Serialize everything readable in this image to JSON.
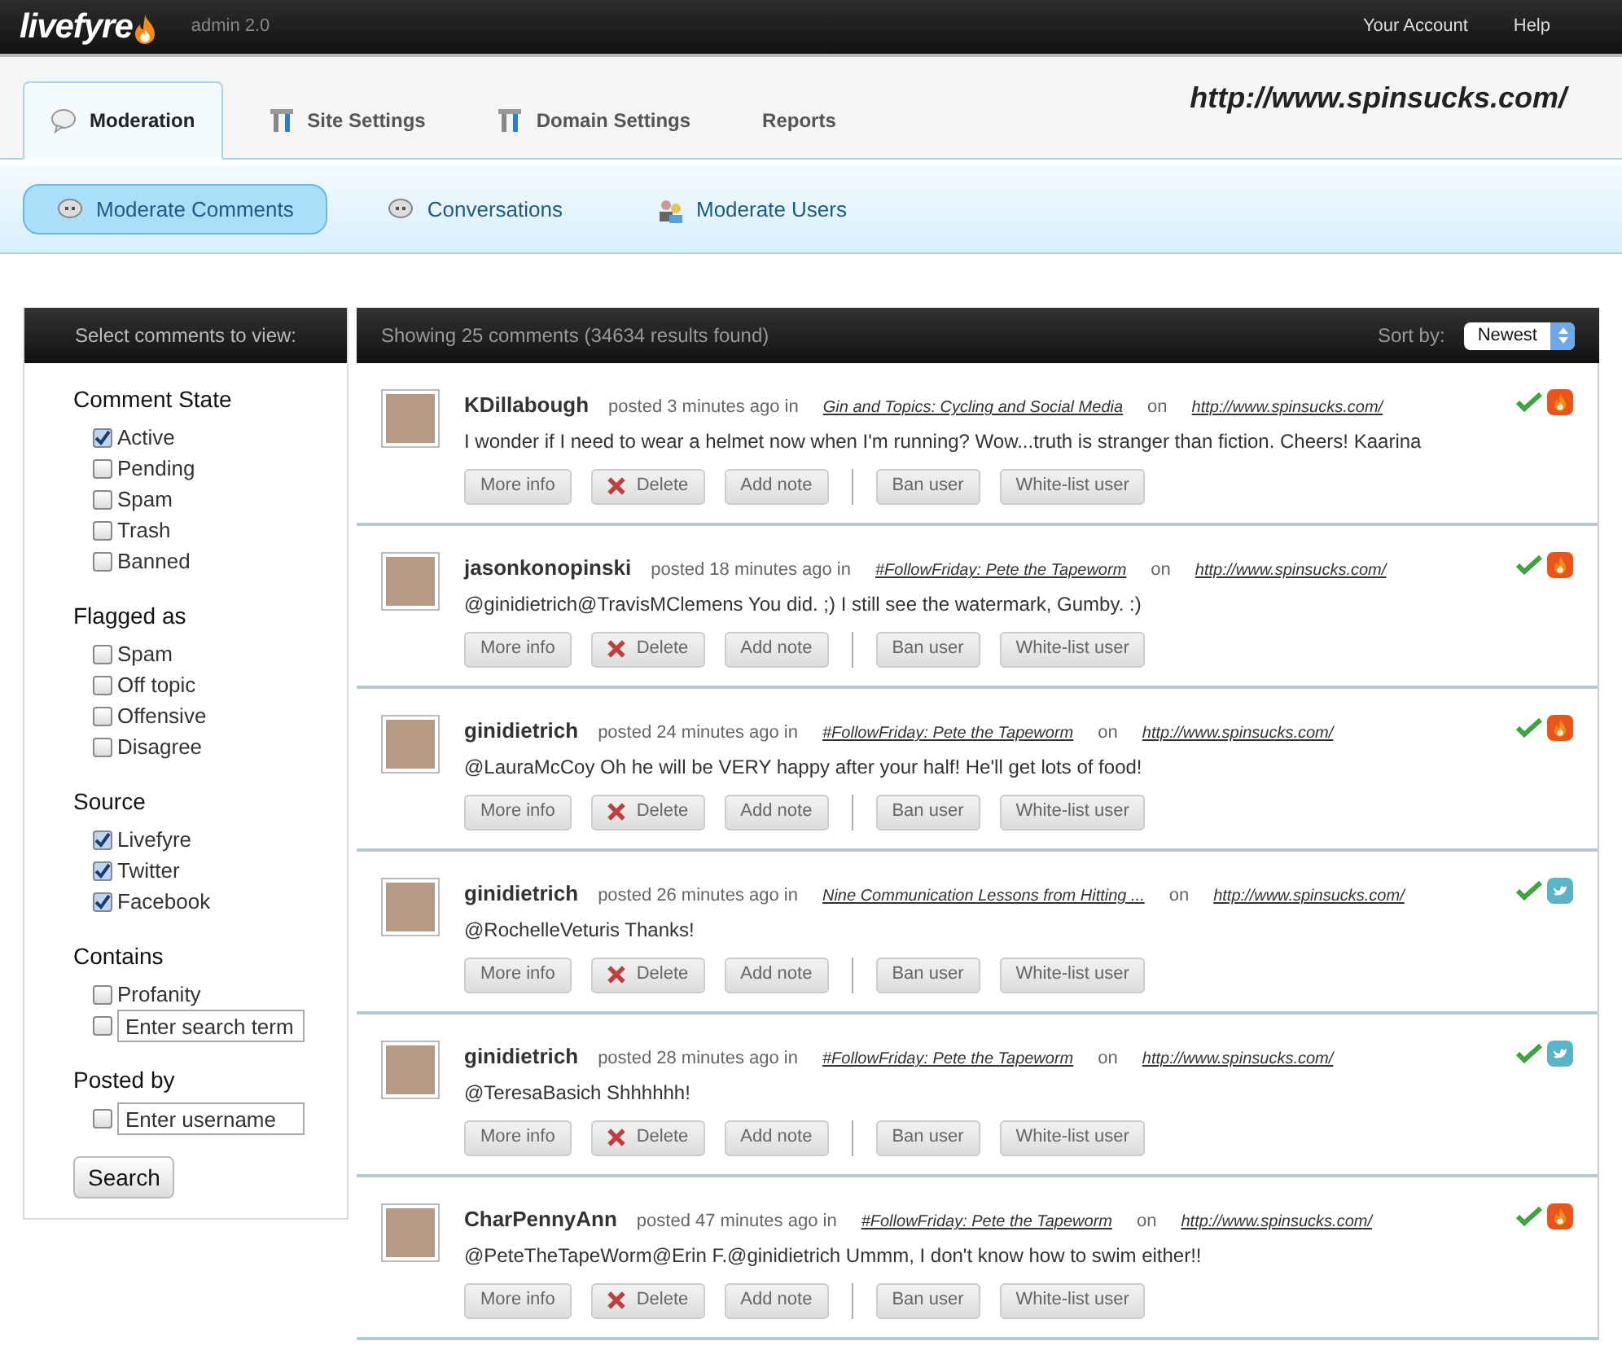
{
  "topbar": {
    "logo": "livefyre",
    "version": "admin 2.0",
    "links": [
      "Your Account",
      "Help"
    ]
  },
  "tabs": [
    {
      "label": "Moderation",
      "kind": "bubble",
      "selected": true
    },
    {
      "label": "Site Settings",
      "kind": "tools",
      "selected": false
    },
    {
      "label": "Domain Settings",
      "kind": "tools",
      "selected": false
    },
    {
      "label": "Reports",
      "kind": "plain",
      "selected": false
    }
  ],
  "site_url": "http://www.spinsucks.com/",
  "subnav": [
    {
      "label": "Moderate Comments",
      "kind": "quote",
      "selected": true
    },
    {
      "label": "Conversations",
      "kind": "quote",
      "selected": false
    },
    {
      "label": "Moderate Users",
      "kind": "users",
      "selected": false
    }
  ],
  "filter": {
    "title": "Select comments to view:",
    "groups": [
      {
        "heading": "Comment State",
        "items": [
          {
            "kind": "checkbox",
            "label": "Active",
            "checked": true
          },
          {
            "kind": "checkbox",
            "label": "Pending",
            "checked": false
          },
          {
            "kind": "checkbox",
            "label": "Spam",
            "checked": false
          },
          {
            "kind": "checkbox",
            "label": "Trash",
            "checked": false
          },
          {
            "kind": "checkbox",
            "label": "Banned",
            "checked": false
          }
        ]
      },
      {
        "heading": "Flagged as",
        "items": [
          {
            "kind": "checkbox",
            "label": "Spam",
            "checked": false
          },
          {
            "kind": "checkbox",
            "label": "Off topic",
            "checked": false
          },
          {
            "kind": "checkbox",
            "label": "Offensive",
            "checked": false
          },
          {
            "kind": "checkbox",
            "label": "Disagree",
            "checked": false
          }
        ]
      },
      {
        "heading": "Source",
        "items": [
          {
            "kind": "checkbox",
            "label": "Livefyre",
            "checked": true
          },
          {
            "kind": "checkbox",
            "label": "Twitter",
            "checked": true
          },
          {
            "kind": "checkbox",
            "label": "Facebook",
            "checked": true
          }
        ]
      },
      {
        "heading": "Contains",
        "items": [
          {
            "kind": "checkbox",
            "label": "Profanity",
            "checked": false
          },
          {
            "kind": "input",
            "placeholder": "Enter search term",
            "checked": false
          }
        ]
      },
      {
        "heading": "Posted by",
        "items": [
          {
            "kind": "input",
            "placeholder": "Enter username",
            "checked": false
          }
        ]
      }
    ],
    "button": "Search"
  },
  "results": {
    "summary": "Showing 25 comments (34634 results found)",
    "sort_label": "Sort by:",
    "sort_value": "Newest"
  },
  "comments": [
    {
      "user": "KDillabough",
      "posted": "posted 3 minutes ago in",
      "conversation": "Gin and Topics: Cycling and Social Media",
      "on": "on",
      "url": "http://www.spinsucks.com/",
      "text": "I wonder if I need to wear a helmet now when I'm running? Wow...truth is stranger than fiction. Cheers! Kaarina",
      "approved": true,
      "kind": "livefyre",
      "actions": [
        [
          {
            "label": "More info",
            "kind": "plain"
          },
          {
            "label": "Delete",
            "kind": "delete"
          },
          {
            "label": "Add note",
            "kind": "plain"
          }
        ],
        [
          {
            "label": "Ban user",
            "kind": "plain"
          },
          {
            "label": "White-list user",
            "kind": "plain"
          }
        ]
      ]
    },
    {
      "user": "jasonkonopinski",
      "posted": "posted 18 minutes ago in",
      "conversation": "#FollowFriday: Pete the Tapeworm",
      "on": "on",
      "url": "http://www.spinsucks.com/",
      "text": "@ginidietrich@TravisMClemens You did. ;) I still see the watermark, Gumby. :)",
      "approved": true,
      "kind": "livefyre",
      "actions": [
        [
          {
            "label": "More info",
            "kind": "plain"
          },
          {
            "label": "Delete",
            "kind": "delete"
          },
          {
            "label": "Add note",
            "kind": "plain"
          }
        ],
        [
          {
            "label": "Ban user",
            "kind": "plain"
          },
          {
            "label": "White-list user",
            "kind": "plain"
          }
        ]
      ]
    },
    {
      "user": "ginidietrich",
      "posted": "posted 24 minutes ago in",
      "conversation": "#FollowFriday: Pete the Tapeworm",
      "on": "on",
      "url": "http://www.spinsucks.com/",
      "text": "@LauraMcCoy Oh he will be VERY happy after your half! He'll get lots of food!",
      "approved": true,
      "kind": "livefyre",
      "actions": [
        [
          {
            "label": "More info",
            "kind": "plain"
          },
          {
            "label": "Delete",
            "kind": "delete"
          },
          {
            "label": "Add note",
            "kind": "plain"
          }
        ],
        [
          {
            "label": "Ban user",
            "kind": "plain"
          },
          {
            "label": "White-list user",
            "kind": "plain"
          }
        ]
      ]
    },
    {
      "user": "ginidietrich",
      "posted": "posted 26 minutes ago in",
      "conversation": "Nine Communication Lessons from Hitting ...",
      "on": "on",
      "url": "http://www.spinsucks.com/",
      "text": "@RochelleVeturis Thanks!",
      "approved": true,
      "kind": "twitter",
      "actions": [
        [
          {
            "label": "More info",
            "kind": "plain"
          },
          {
            "label": "Delete",
            "kind": "delete"
          },
          {
            "label": "Add note",
            "kind": "plain"
          }
        ],
        [
          {
            "label": "Ban user",
            "kind": "plain"
          },
          {
            "label": "White-list user",
            "kind": "plain"
          }
        ]
      ]
    },
    {
      "user": "ginidietrich",
      "posted": "posted 28 minutes ago in",
      "conversation": "#FollowFriday: Pete the Tapeworm",
      "on": "on",
      "url": "http://www.spinsucks.com/",
      "text": "@TeresaBasich Shhhhhh!",
      "approved": true,
      "kind": "twitter",
      "actions": [
        [
          {
            "label": "More info",
            "kind": "plain"
          },
          {
            "label": "Delete",
            "kind": "delete"
          },
          {
            "label": "Add note",
            "kind": "plain"
          }
        ],
        [
          {
            "label": "Ban user",
            "kind": "plain"
          },
          {
            "label": "White-list user",
            "kind": "plain"
          }
        ]
      ]
    },
    {
      "user": "CharPennyAnn",
      "posted": "posted 47 minutes ago in",
      "conversation": "#FollowFriday: Pete the Tapeworm",
      "on": "on",
      "url": "http://www.spinsucks.com/",
      "text": "@PeteTheTapeWorm@Erin F.@ginidietrich Ummm, I don't know how to swim either!!",
      "approved": true,
      "kind": "livefyre",
      "actions": [
        [
          {
            "label": "More info",
            "kind": "plain"
          },
          {
            "label": "Delete",
            "kind": "delete"
          },
          {
            "label": "Add note",
            "kind": "plain"
          }
        ],
        [
          {
            "label": "Ban user",
            "kind": "plain"
          },
          {
            "label": "White-list user",
            "kind": "plain"
          }
        ]
      ]
    }
  ]
}
